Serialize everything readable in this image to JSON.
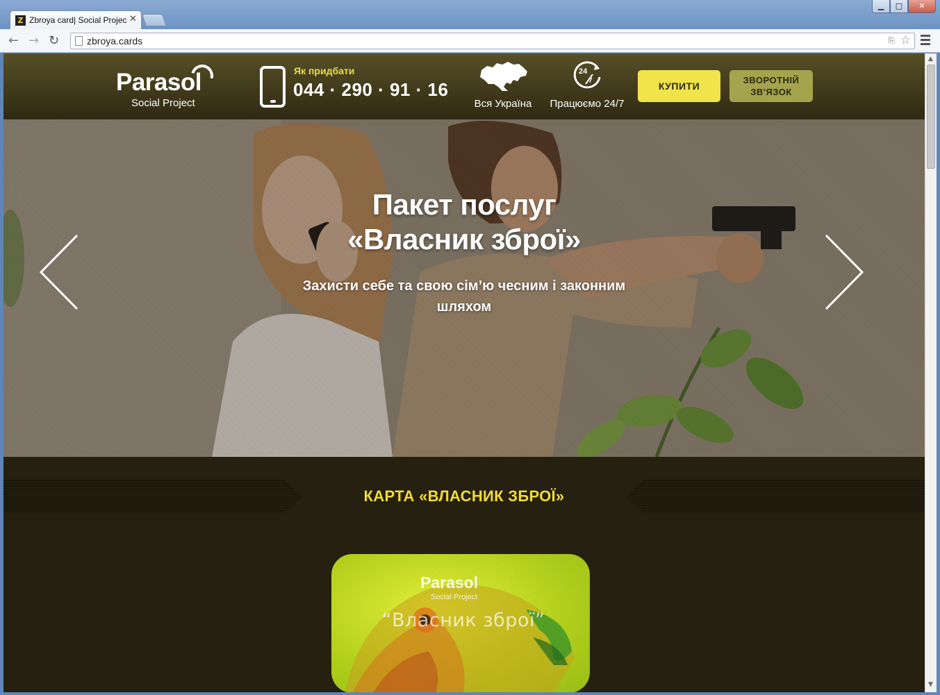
{
  "browser": {
    "tab_title": "Zbroya card| Social Project",
    "tab_favicon": "Z",
    "url": "zbroya.cards",
    "window_controls": {
      "minimize": "▁",
      "maximize": "□",
      "close": "✕"
    }
  },
  "header": {
    "logo_name": "Parasol",
    "logo_sub": "Social Project",
    "how_to_buy_label": "Як придбати",
    "phone": "044 · 290 · 91 · 16",
    "region_label": "Вся Україна",
    "hours_label": "Працюємо 24/7",
    "buy_button": "КУПИТИ",
    "feedback_button_line1": "ЗВОРОТНІЙ",
    "feedback_button_line2": "ЗВ'ЯЗОК"
  },
  "hero": {
    "title_line1": "Пакет послуг",
    "title_line2": "«Власник зброї»",
    "subtitle": "Захисти себе та свою сім’ю чесним і законним шляхом"
  },
  "card_section": {
    "title": "КАРТА «ВЛАСНИК ЗБРОЇ»",
    "card_logo": "Parasol",
    "card_sub": "Social Project",
    "card_quote": "“Власник зброї”"
  },
  "colors": {
    "accent_yellow": "#f1e34a",
    "feedback_olive": "#a5a44e",
    "section_title_yellow": "#f1dc36",
    "page_bg": "#252010"
  },
  "icons": [
    "phone-icon",
    "ukraine-map-icon",
    "clock-24-icon",
    "chevron-left-icon",
    "chevron-right-icon",
    "star-icon",
    "translate-icon",
    "menu-icon"
  ]
}
